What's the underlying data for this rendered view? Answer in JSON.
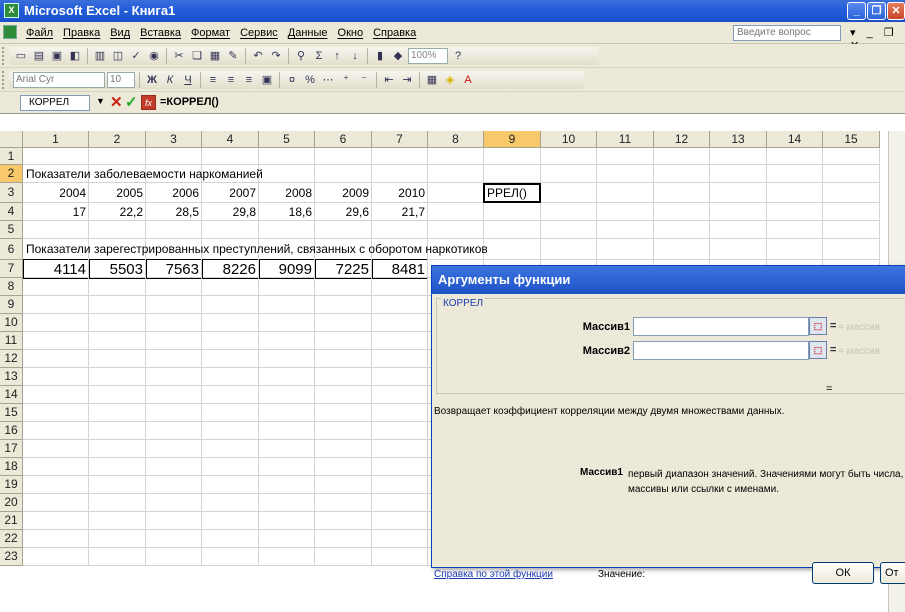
{
  "window": {
    "title": "Microsoft Excel - Книга1",
    "app_icon_label": "X",
    "minimize_glyph": "_",
    "restore_glyph": "❐",
    "close_glyph": "✕"
  },
  "menubar": {
    "items": [
      "Файл",
      "Правка",
      "Вид",
      "Вставка",
      "Формат",
      "Сервис",
      "Данные",
      "Окно",
      "Справка"
    ],
    "ask_placeholder": "Введите вопрос",
    "right_controls": "▾ _ ❐ ✕"
  },
  "toolbar": {
    "zoom": "100%",
    "font_name": "Arial Cyr",
    "font_size": "10"
  },
  "formula_bar": {
    "name_box": "КОРРЕЛ",
    "cancel_glyph": "✕",
    "enter_glyph": "✓",
    "fx_label": "fx",
    "formula": "=КОРРЕЛ()"
  },
  "sheet": {
    "columns": [
      "1",
      "2",
      "3",
      "4",
      "5",
      "6",
      "7",
      "8",
      "9",
      "10",
      "11",
      "12",
      "13",
      "14",
      "15"
    ],
    "rows": [
      "1",
      "2",
      "3",
      "4",
      "5",
      "6",
      "7",
      "8",
      "9",
      "10",
      "11",
      "12",
      "13",
      "14",
      "15",
      "16",
      "17",
      "18",
      "19",
      "20",
      "21",
      "22",
      "23"
    ],
    "active_col": "9",
    "active_row": "2",
    "r1_text": "Показатели заболеваемости наркоманией",
    "r2_years": [
      "2004",
      "2005",
      "2006",
      "2007",
      "2008",
      "2009",
      "2010"
    ],
    "r3_values": [
      "17",
      "22,2",
      "28,5",
      "29,8",
      "18,6",
      "29,6",
      "21,7"
    ],
    "r5_text": "Показатели зарегестрированных преступлений, связанных с оборотом наркотиков",
    "r6_values": [
      "4114",
      "5503",
      "7563",
      "8226",
      "9099",
      "7225",
      "8481"
    ],
    "active_cell_text": "РРЕЛ()"
  },
  "dialog": {
    "title": "Аргументы функции",
    "group_label": "КОРРЕЛ",
    "arg1_label": "Массив1",
    "arg2_label": "Массив2",
    "arg1_hint": "= массив",
    "arg2_hint": "= массив",
    "result_eq": "=",
    "description": "Возвращает коэффициент корреляции между двумя множествами данных.",
    "arg_desc_name": "Массив1",
    "arg_desc_text": "первый диапазон значений. Значениями могут быть числа, массивы или ссылки с именами.",
    "help_link": "Справка по этой функции",
    "value_label": "Значение:",
    "ok_label": "ОК",
    "cancel_label": "От"
  }
}
